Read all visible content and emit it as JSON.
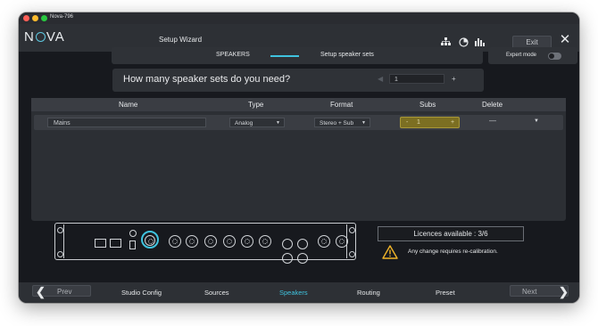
{
  "window": {
    "title": "Nova-796"
  },
  "header": {
    "logo": "N",
    "logo_tail": "VA",
    "title": "Setup Wizard",
    "exit_label": "Exit",
    "icons": [
      "network-icon",
      "clock-icon",
      "levels-icon"
    ]
  },
  "stepper": {
    "step1": "SPEAKERS",
    "step2": "Setup speaker sets",
    "accent": "#3fc3df"
  },
  "expert_mode": {
    "label": "Expert mode",
    "enabled": false
  },
  "question": {
    "text": "How many speaker sets do you need?",
    "value": "1",
    "dec": "◀",
    "inc": "+"
  },
  "table": {
    "columns": [
      "Name",
      "Type",
      "Format",
      "Subs",
      "Delete"
    ],
    "rows": [
      {
        "name": "Mains",
        "type": "Analog",
        "format": "Stereo + Sub",
        "subs": "1",
        "subs_dec": "-",
        "subs_inc": "+",
        "delete": "—"
      }
    ]
  },
  "licences": {
    "text": "Licences available : 3/6"
  },
  "warning": {
    "text": "Any change requires re-calibration.",
    "color": "#f0b429"
  },
  "footer": {
    "prev": "Prev",
    "next": "Next",
    "tabs": [
      "Studio Config",
      "Sources",
      "Speakers",
      "Routing",
      "Preset"
    ],
    "active_tab": "Speakers"
  }
}
